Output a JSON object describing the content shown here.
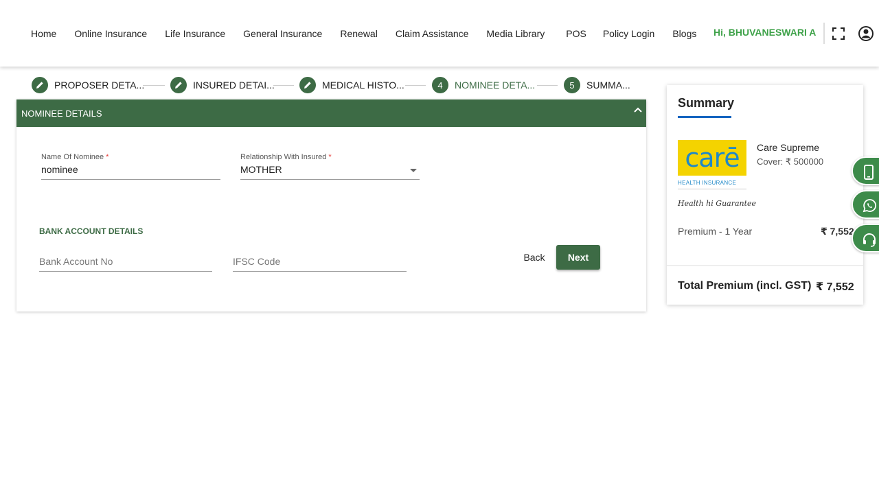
{
  "nav": {
    "items": [
      "Home",
      "Online Insurance",
      "Life Insurance",
      "General Insurance",
      "Renewal",
      "Claim Assistance",
      "Media Library",
      "POS",
      "Policy Login",
      "Blogs"
    ],
    "greeting": "Hi, BHUVANESWARI A",
    "icons": [
      "fullscreen-icon",
      "account-circle-icon"
    ]
  },
  "stepper": {
    "steps": [
      {
        "label": "PROPOSER DETA...",
        "marker": "edit-icon"
      },
      {
        "label": "INSURED DETAI...",
        "marker": "edit-icon"
      },
      {
        "label": "MEDICAL HISTO...",
        "marker": "edit-icon"
      },
      {
        "label": "NOMINEE DETA...",
        "marker": "4"
      },
      {
        "label": "SUMMA...",
        "marker": "5"
      }
    ]
  },
  "form": {
    "section_title": "NOMINEE DETAILS",
    "nominee_name": {
      "label": "Name Of Nominee",
      "required": "*",
      "value": "nominee"
    },
    "relationship": {
      "label": "Relationship With Insured",
      "required": "*",
      "value": "MOTHER"
    },
    "bank_title": "BANK ACCOUNT DETAILS",
    "bank_account": {
      "placeholder": "Bank Account No"
    },
    "ifsc": {
      "placeholder": "IFSC Code"
    },
    "back_label": "Back",
    "next_label": "Next"
  },
  "summary": {
    "title": "Summary",
    "logo": {
      "word": "carē",
      "sub": "HEALTH INSURANCE",
      "tagline": "Health hi Guarantee"
    },
    "plan_name": "Care Supreme",
    "cover": "Cover: ₹ 500000",
    "premium_label": "Premium - 1 Year",
    "premium_value": "₹ 7,552",
    "total_label": "Total Premium (incl. GST)",
    "total_value": "₹ 7,552"
  },
  "floating": [
    "phone-icon",
    "whatsapp-icon",
    "support-headset-icon"
  ],
  "colors": {
    "primary_green": "#3d6b45",
    "greeting_green": "#3fa24a",
    "accent_blue": "#1565c0",
    "float_green": "#3d8b4a"
  }
}
